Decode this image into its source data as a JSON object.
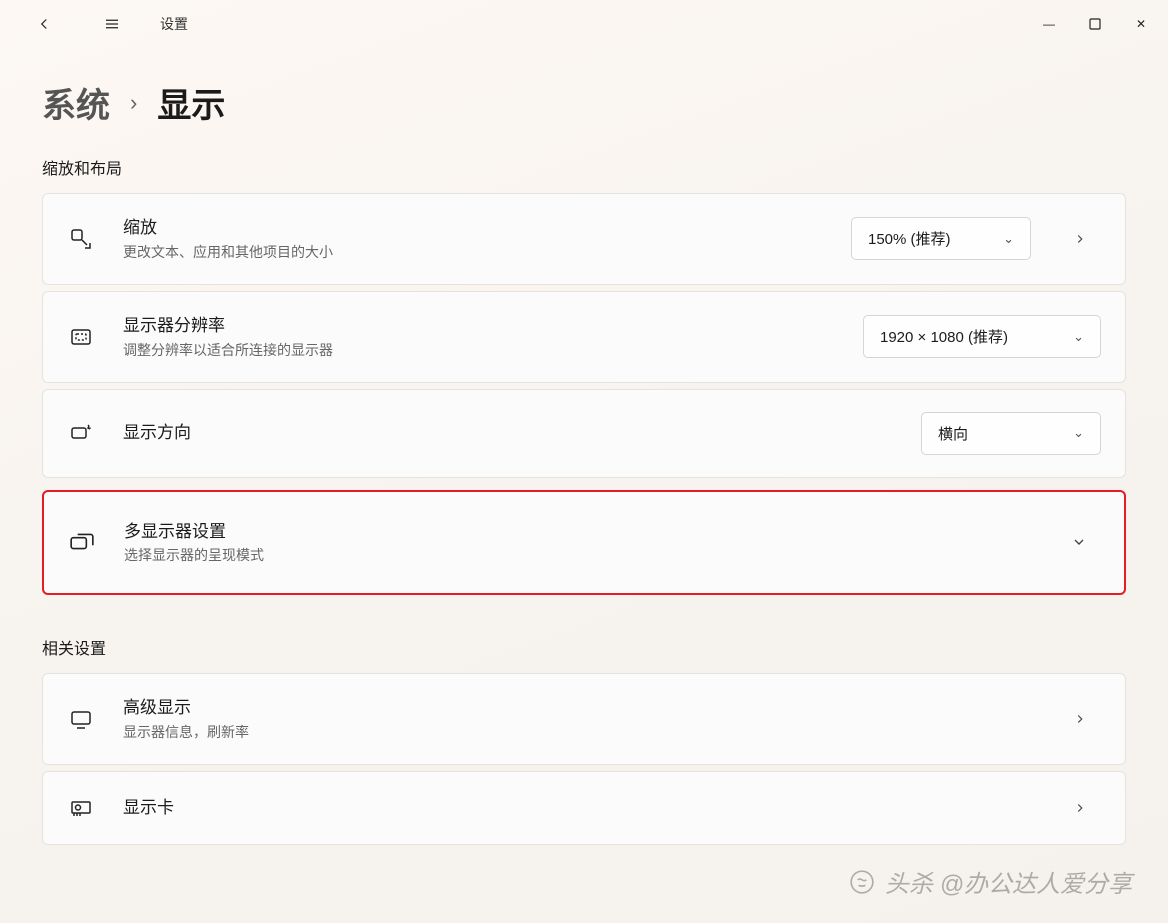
{
  "titlebar": {
    "minimize_glyph": "—",
    "maximize_glyph": "☐",
    "close_glyph": "✕"
  },
  "header": {
    "app_title": "设置"
  },
  "breadcrumb": {
    "parent": "系统",
    "separator": "›",
    "current": "显示"
  },
  "sections": {
    "layout_title": "缩放和布局",
    "related_title": "相关设置"
  },
  "scale": {
    "title": "缩放",
    "subtitle": "更改文本、应用和其他项目的大小",
    "value": "150% (推荐)"
  },
  "resolution": {
    "title": "显示器分辨率",
    "subtitle": "调整分辨率以适合所连接的显示器",
    "value": "1920 × 1080 (推荐)"
  },
  "orientation": {
    "title": "显示方向",
    "value": "横向"
  },
  "multi": {
    "title": "多显示器设置",
    "subtitle": "选择显示器的呈现模式"
  },
  "advanced": {
    "title": "高级显示",
    "subtitle": "显示器信息，刷新率"
  },
  "graphics": {
    "title": "显示卡"
  },
  "watermark": "头杀 @办公达人爱分享"
}
